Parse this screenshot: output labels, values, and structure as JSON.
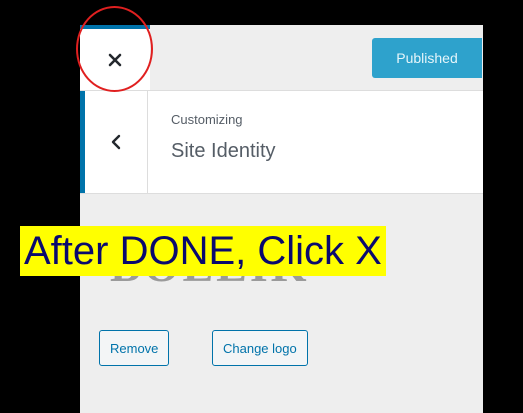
{
  "header": {
    "close_icon": "close-x-icon",
    "publish_label": "Published"
  },
  "section": {
    "back_icon": "chevron-left-icon",
    "breadcrumb": "Customizing",
    "title": "Site Identity"
  },
  "logo": {
    "preview_text": "BOLLIK",
    "remove_label": "Remove",
    "change_label": "Change logo"
  },
  "annotation": {
    "caption": "After DONE, Click X",
    "highlight_color": "#ffff00",
    "circle_color": "#e02020"
  },
  "colors": {
    "accent": "#0073aa",
    "publish_button": "#2ea2cc"
  }
}
